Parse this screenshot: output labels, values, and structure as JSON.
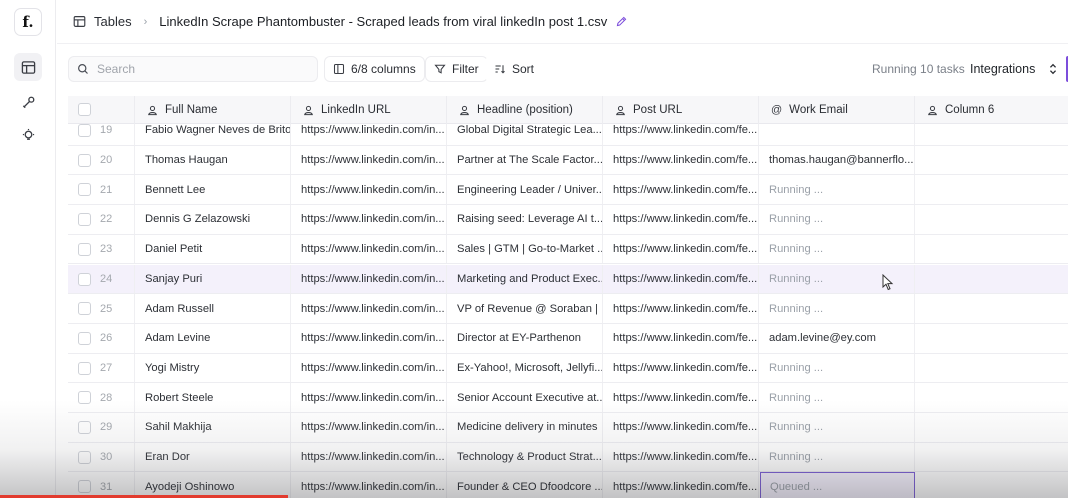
{
  "app": {
    "logo": "f."
  },
  "breadcrumb": {
    "root": "Tables",
    "file": "LinkedIn Scrape Phantombuster - Scraped leads from viral linkedIn post 1.csv"
  },
  "toolbar": {
    "search_placeholder": "Search",
    "columns_label": "6/8 columns",
    "filter_label": "Filter",
    "sort_label": "Sort",
    "running_text": "Running 10 tasks",
    "integrations_label": "Integrations"
  },
  "columns": [
    "Full Name",
    "LinkedIn URL",
    "Headline (position)",
    "Post URL",
    "Work Email",
    "Column 6"
  ],
  "rows": [
    {
      "n": "19",
      "name": "Fabio Wagner Neves de Brito",
      "url": "https://www.linkedin.com/in...",
      "headline": "Global Digital Strategic Lea...",
      "post": "https://www.linkedin.com/fe...",
      "email": "",
      "state": "value"
    },
    {
      "n": "20",
      "name": "Thomas Haugan",
      "url": "https://www.linkedin.com/in...",
      "headline": "Partner at The Scale Factor...",
      "post": "https://www.linkedin.com/fe...",
      "email": "thomas.haugan@bannerflo...",
      "state": "value"
    },
    {
      "n": "21",
      "name": "Bennett Lee",
      "url": "https://www.linkedin.com/in...",
      "headline": "Engineering Leader / Univer...",
      "post": "https://www.linkedin.com/fe...",
      "email": "Running ...",
      "state": "muted"
    },
    {
      "n": "22",
      "name": "Dennis G Zelazowski",
      "url": "https://www.linkedin.com/in...",
      "headline": "Raising seed: Leverage AI t...",
      "post": "https://www.linkedin.com/fe...",
      "email": "Running ...",
      "state": "muted"
    },
    {
      "n": "23",
      "name": "Daniel Petit",
      "url": "https://www.linkedin.com/in...",
      "headline": "Sales | GTM | Go-to-Market ...",
      "post": "https://www.linkedin.com/fe...",
      "email": "Running ...",
      "state": "muted"
    },
    {
      "n": "24",
      "name": "Sanjay Puri",
      "url": "https://www.linkedin.com/in...",
      "headline": "Marketing and Product Exec...",
      "post": "https://www.linkedin.com/fe...",
      "email": "Running ...",
      "state": "muted"
    },
    {
      "n": "25",
      "name": "Adam Russell",
      "url": "https://www.linkedin.com/in...",
      "headline": "VP of Revenue @ Soraban | ...",
      "post": "https://www.linkedin.com/fe...",
      "email": "Running ...",
      "state": "muted"
    },
    {
      "n": "26",
      "name": "Adam Levine",
      "url": "https://www.linkedin.com/in...",
      "headline": "Director at EY-Parthenon",
      "post": "https://www.linkedin.com/fe...",
      "email": "adam.levine@ey.com",
      "state": "value"
    },
    {
      "n": "27",
      "name": "Yogi Mistry",
      "url": "https://www.linkedin.com/in...",
      "headline": "Ex-Yahoo!, Microsoft, Jellyfi...",
      "post": "https://www.linkedin.com/fe...",
      "email": "Running ...",
      "state": "muted"
    },
    {
      "n": "28",
      "name": "Robert Steele",
      "url": "https://www.linkedin.com/in...",
      "headline": "Senior Account Executive at...",
      "post": "https://www.linkedin.com/fe...",
      "email": "Running ...",
      "state": "muted"
    },
    {
      "n": "29",
      "name": "Sahil Makhija",
      "url": "https://www.linkedin.com/in...",
      "headline": "Medicine delivery in minutes",
      "post": "https://www.linkedin.com/fe...",
      "email": "Running ...",
      "state": "muted"
    },
    {
      "n": "30",
      "name": "Eran Dor",
      "url": "https://www.linkedin.com/in...",
      "headline": "Technology & Product Strat...",
      "post": "https://www.linkedin.com/fe...",
      "email": "Running ...",
      "state": "muted"
    },
    {
      "n": "31",
      "name": "Ayodeji Oshinowo",
      "url": "https://www.linkedin.com/in...",
      "headline": "Founder & CEO Dfoodcore ...",
      "post": "https://www.linkedin.com/fe...",
      "email": "Queued ...",
      "state": "queued"
    }
  ],
  "highlight_row": "24",
  "colors": {
    "accent": "#7c4ddb",
    "row_highlight": "#f4f1fb",
    "muted_text": "#9aa0a8"
  },
  "icons": [
    "table-icon",
    "pencil-icon",
    "search-icon",
    "columns-icon",
    "filter-icon",
    "sort-icon",
    "chevron-updown-icon",
    "user-icon",
    "at-icon",
    "tools-icon",
    "bulb-icon",
    "mouse-cursor-icon"
  ]
}
